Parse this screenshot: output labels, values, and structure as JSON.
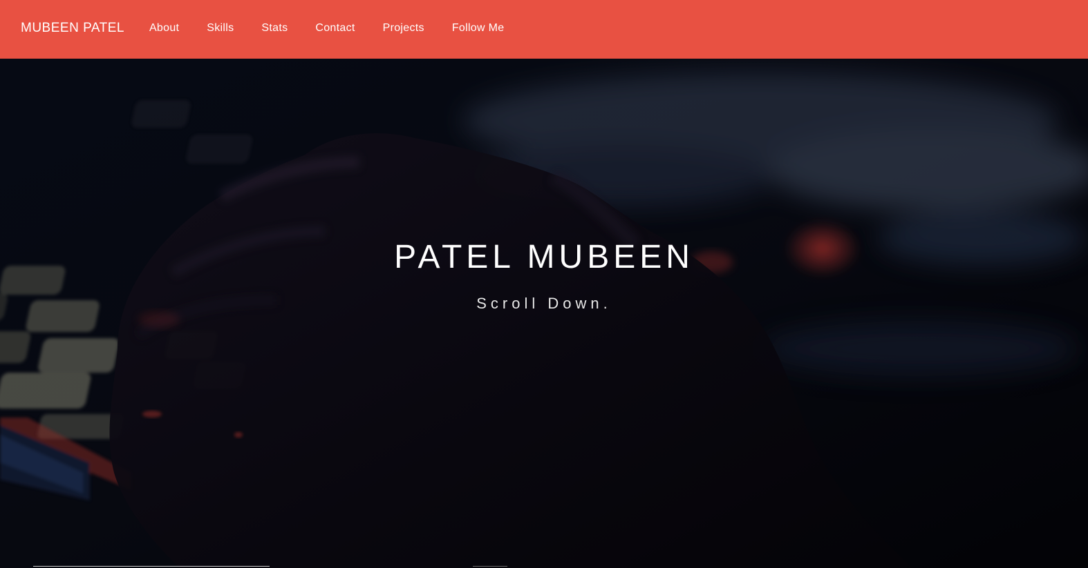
{
  "navbar": {
    "brand": "MUBEEN PATEL",
    "links": [
      "About",
      "Skills",
      "Stats",
      "Contact",
      "Projects",
      "Follow Me"
    ],
    "background_color": "#e85142"
  },
  "hero": {
    "title": "PATEL MUBEEN",
    "subtitle": "Scroll Down."
  }
}
